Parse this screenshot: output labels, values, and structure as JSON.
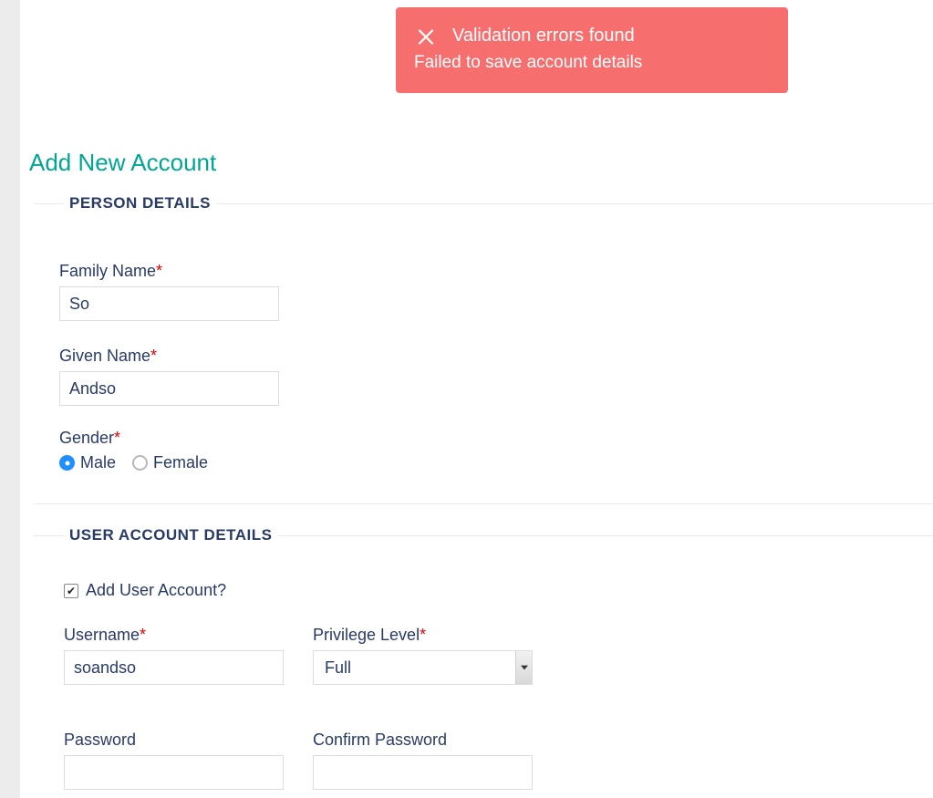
{
  "toast": {
    "title": "Validation errors found",
    "message": "Failed to save account details"
  },
  "page": {
    "title": "Add New Account"
  },
  "sections": {
    "person": {
      "legend": "PERSON DETAILS"
    },
    "account": {
      "legend": "USER ACCOUNT DETAILS"
    }
  },
  "fields": {
    "family_name": {
      "label": "Family Name",
      "value": "So"
    },
    "given_name": {
      "label": "Given Name",
      "value": "Andso"
    },
    "gender": {
      "label": "Gender",
      "options": {
        "male": "Male",
        "female": "Female"
      },
      "selected": "male"
    },
    "add_user_account": {
      "label": "Add User Account?",
      "checked": true
    },
    "username": {
      "label": "Username",
      "value": "soandso"
    },
    "privilege_level": {
      "label": "Privilege Level",
      "value": "Full"
    },
    "password": {
      "label": "Password",
      "value": ""
    },
    "confirm_password": {
      "label": "Confirm Password",
      "value": ""
    }
  },
  "required_marker": "*",
  "checkmark_glyph": "✔"
}
